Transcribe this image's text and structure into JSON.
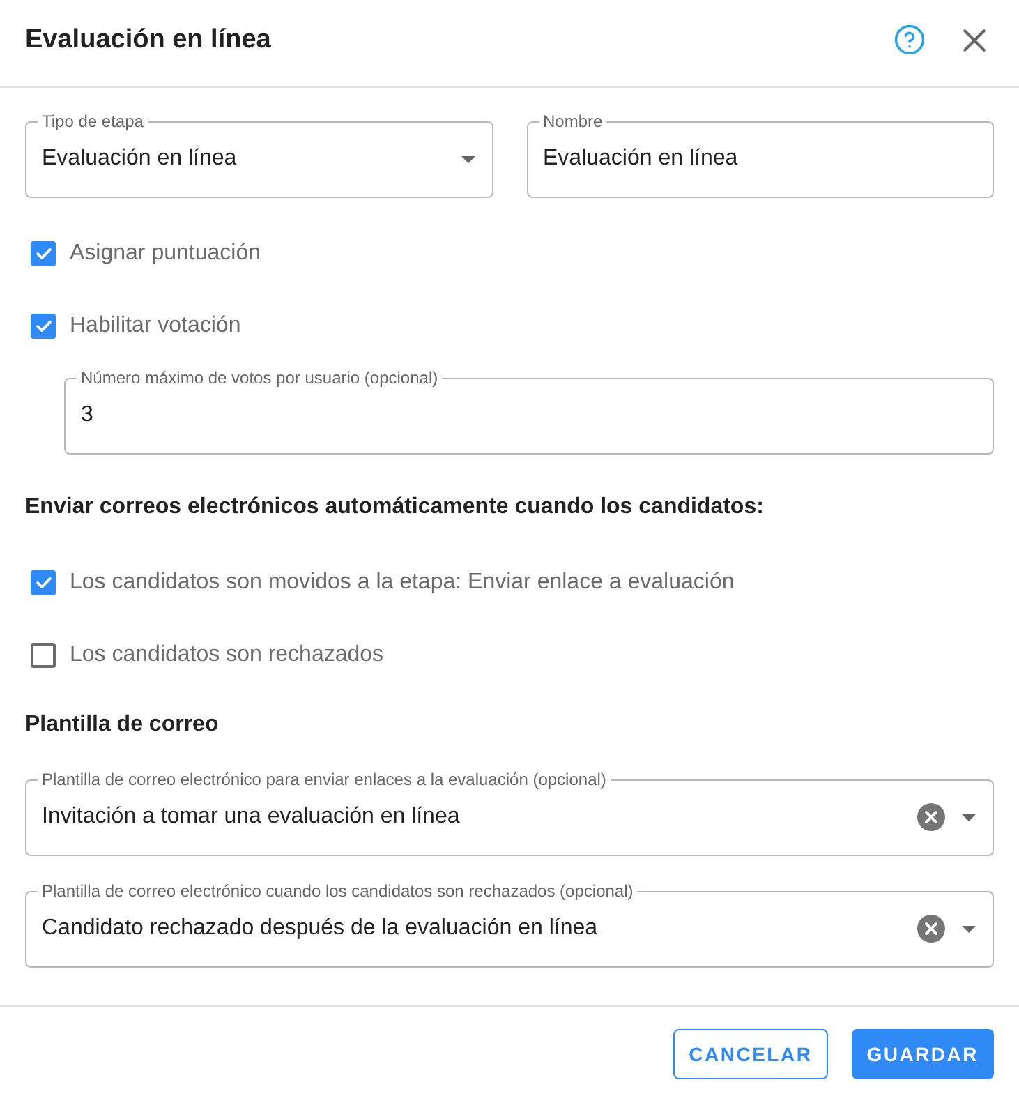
{
  "dialog": {
    "title": "Evaluación en línea"
  },
  "stage_fields": [
    {
      "kind": "select",
      "label": "Tipo de etapa",
      "value": "Evaluación en línea"
    },
    {
      "kind": "text",
      "label": "Nombre",
      "value": "Evaluación en línea"
    }
  ],
  "options": [
    {
      "label": "Asignar puntuación",
      "checked": true
    },
    {
      "label": "Habilitar votación",
      "checked": true,
      "field": {
        "kind": "text",
        "label": "Número máximo de votos por usuario (opcional)",
        "value": "3"
      }
    }
  ],
  "email_section": {
    "heading": "Enviar correos electrónicos automáticamente cuando los candidatos:",
    "triggers": [
      {
        "label": "Los candidatos son movidos a la etapa: Enviar enlace a evaluación",
        "checked": true
      },
      {
        "label": "Los candidatos son rechazados",
        "checked": false
      }
    ]
  },
  "template_section": {
    "heading": "Plantilla de correo",
    "fields": [
      {
        "kind": "select",
        "label": "Plantilla de correo electrónico para enviar enlaces a la evaluación (opcional)",
        "value": "Invitación a tomar una evaluación en línea",
        "clearable": true
      },
      {
        "kind": "select",
        "label": "Plantilla de correo electrónico cuando los candidatos son rechazados (opcional)",
        "value": "Candidato rechazado después de la evaluación en línea",
        "clearable": true
      }
    ]
  },
  "footer": {
    "buttons": [
      {
        "label": "CANCELAR",
        "kind": "outlined"
      },
      {
        "label": "GUARDAR",
        "kind": "contained"
      }
    ]
  }
}
